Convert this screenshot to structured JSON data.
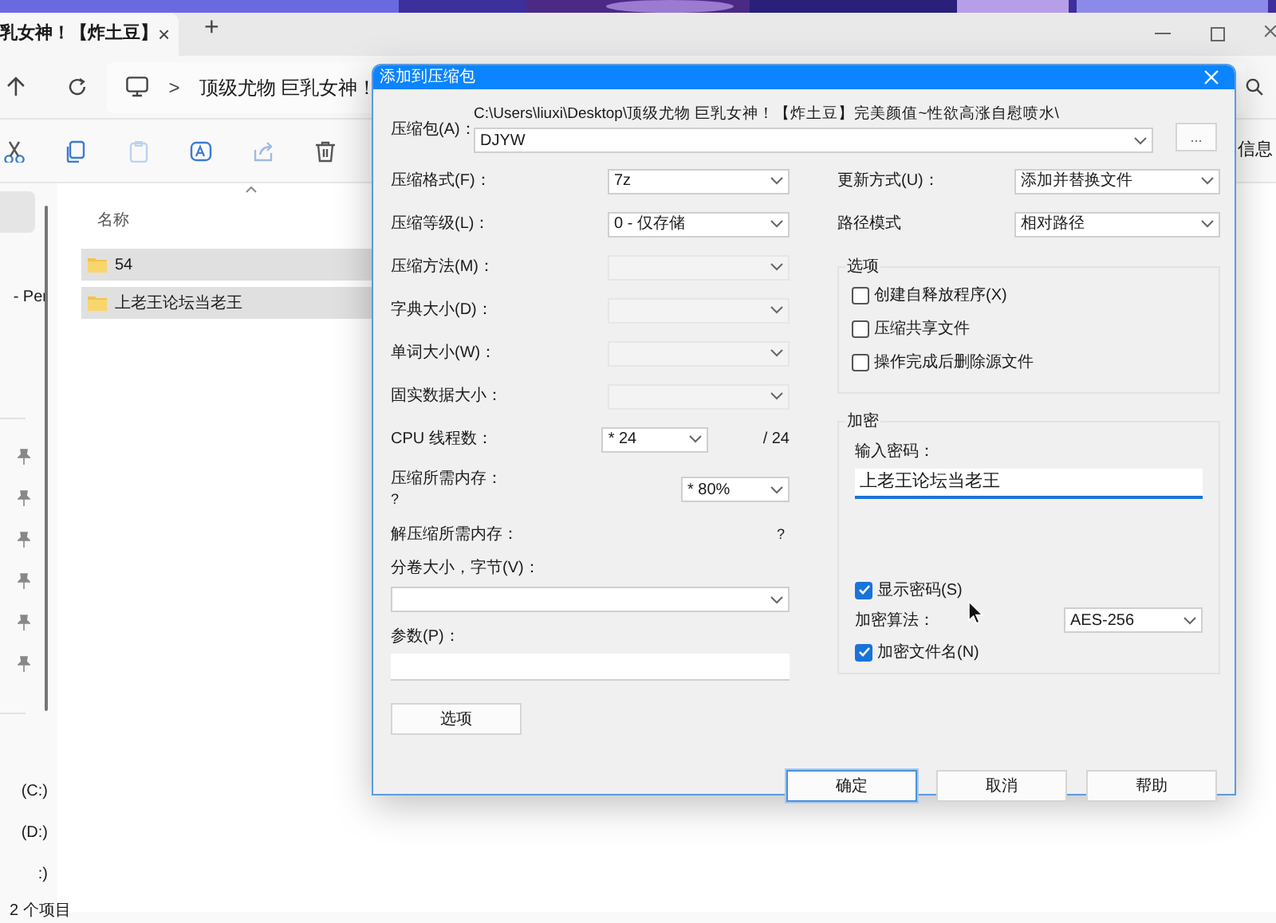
{
  "explorer": {
    "tab": {
      "title": "乳女神！【炸土豆】",
      "close": "×",
      "new_tab": "+"
    },
    "address": {
      "separator": ">",
      "path": "顶级尤物 巨乳女神！"
    },
    "details_label": "信息",
    "sidebar": [
      {
        "kind": "text",
        "label": "- Per",
        "selected": false
      },
      {
        "kind": "pin"
      },
      {
        "kind": "pin"
      },
      {
        "kind": "pin"
      },
      {
        "kind": "pin"
      },
      {
        "kind": "pin"
      },
      {
        "kind": "pin"
      },
      {
        "kind": "text",
        "label": "(C:)",
        "selected": false
      },
      {
        "kind": "text",
        "label": "(D:)",
        "selected": false
      },
      {
        "kind": "text",
        "label": ":)",
        "selected": false
      }
    ],
    "file_list": {
      "column": "名称",
      "rows": [
        {
          "name": "54",
          "selected": true
        },
        {
          "name": "上老王论坛当老王",
          "selected": true
        }
      ]
    },
    "status_bar": "2 个项目"
  },
  "dialog": {
    "title": "添加到压缩包",
    "archive_label": "压缩包(A)：",
    "archive_path": "C:\\Users\\liuxi\\Desktop\\顶级尤物 巨乳女神！【炸土豆】完美颜值~性欲高涨自慰喷水\\",
    "archive_name": "DJYW",
    "browse_button": "...",
    "left_fields": [
      {
        "kind": "select",
        "label": "压缩格式(F)：",
        "value": "7z",
        "disabled": false
      },
      {
        "kind": "select",
        "label": "压缩等级(L)：",
        "value": "0 - 仅存储",
        "disabled": false
      },
      {
        "kind": "select",
        "label": "压缩方法(M)：",
        "disabled": true
      },
      {
        "kind": "select",
        "label": "字典大小(D)：",
        "disabled": true
      },
      {
        "kind": "select",
        "label": "单词大小(W)：",
        "disabled": true
      },
      {
        "kind": "select",
        "label": "固实数据大小：",
        "disabled": true
      },
      {
        "kind": "threads",
        "label": "CPU 线程数：",
        "value": "* 24",
        "max": "/ 24"
      },
      {
        "kind": "memory",
        "label": "压缩所需内存：",
        "note": "?",
        "value": "* 80%"
      },
      {
        "kind": "info",
        "label": "解压缩所需内存：",
        "note": "?"
      },
      {
        "kind": "combo",
        "label": "分卷大小，字节(V)："
      },
      {
        "kind": "input",
        "label": "参数(P)："
      }
    ],
    "options_button": "选项",
    "right_fields": [
      {
        "label": "更新方式(U)：",
        "value": "添加并替换文件"
      },
      {
        "label": "路径模式",
        "value": "相对路径"
      }
    ],
    "options_group": {
      "title": "选项",
      "items": [
        {
          "label": "创建自释放程序(X)",
          "checked": false
        },
        {
          "label": "压缩共享文件",
          "checked": false
        },
        {
          "label": "操作完成后删除源文件",
          "checked": false
        }
      ]
    },
    "encryption": {
      "title": "加密",
      "password_label": "输入密码：",
      "password": "上老王论坛当老王",
      "show_password": {
        "label": "显示密码(S)",
        "checked": true
      },
      "method_label": "加密算法：",
      "method": "AES-256",
      "encrypt_names": {
        "label": "加密文件名(N)",
        "checked": true
      }
    },
    "buttons": [
      {
        "label": "确定",
        "focused": true
      },
      {
        "label": "取消",
        "focused": false
      },
      {
        "label": "帮助",
        "focused": false
      }
    ]
  }
}
